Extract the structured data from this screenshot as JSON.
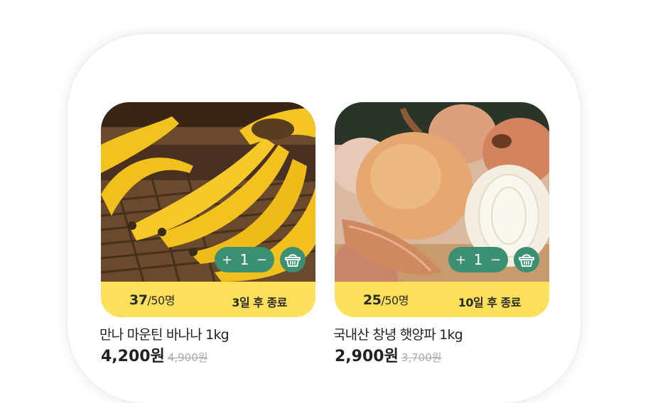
{
  "products": [
    {
      "photo": "bananas",
      "participants": "37",
      "capacity": "/50명",
      "deadline": "3일 후 종료",
      "quantity": "1",
      "plus": "+",
      "minus": "−",
      "name": "만나 마운틴 바나나 1kg",
      "price": "4,200원",
      "original_price": "4,900원"
    },
    {
      "photo": "onions",
      "participants": "25",
      "capacity": "/50명",
      "deadline": "10일 후 종료",
      "quantity": "1",
      "plus": "+",
      "minus": "−",
      "name": "국내산 창녕 햇양파 1kg",
      "price": "2,900원",
      "original_price": "3,700원"
    }
  ],
  "colors": {
    "accent_green": "#3b8f73",
    "info_bar_yellow": "#fde05a"
  },
  "icons": {
    "cart": "basket-icon"
  }
}
